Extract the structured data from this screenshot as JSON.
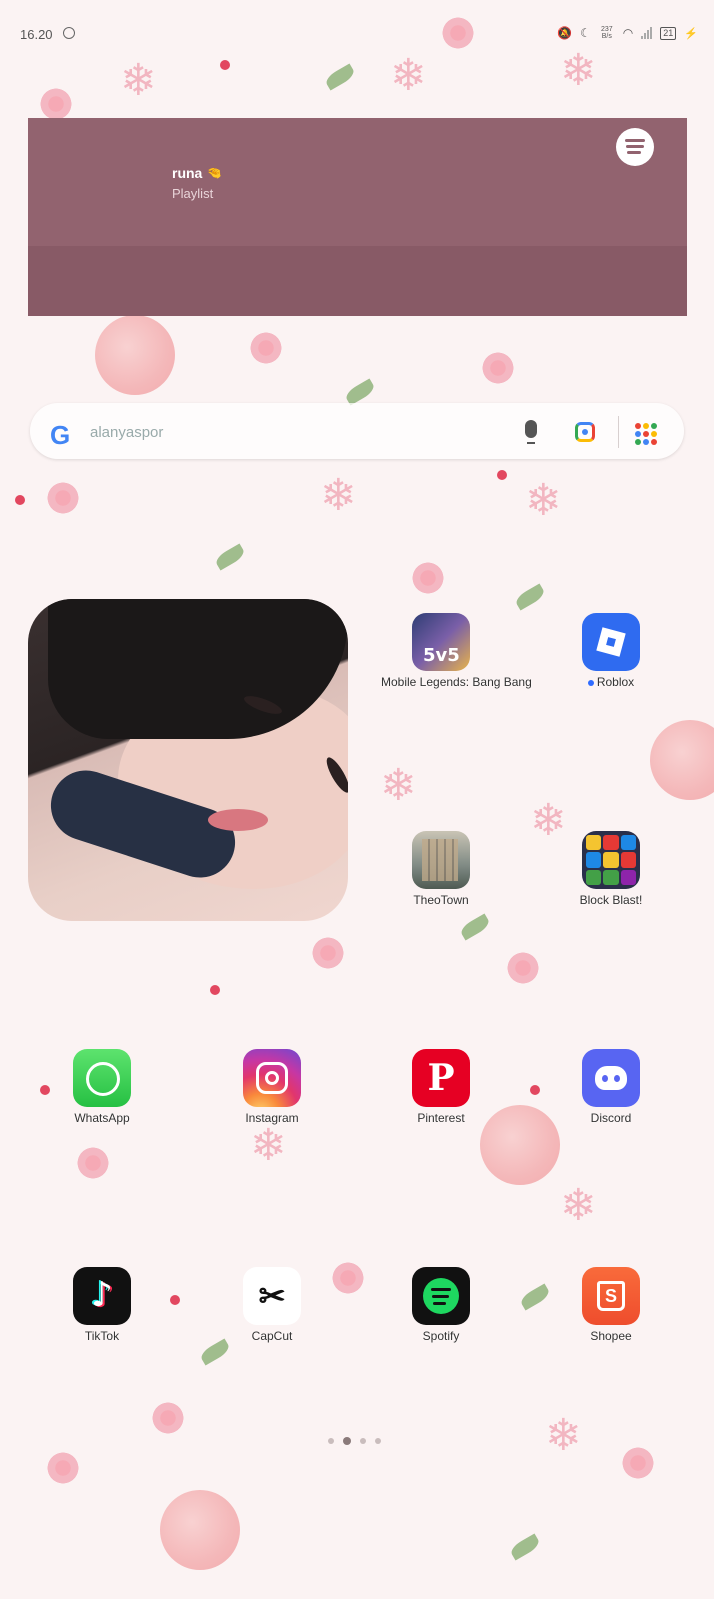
{
  "status_bar": {
    "time": "16.20",
    "speed_value": "237",
    "speed_unit": "B/s",
    "battery": "21",
    "icons": [
      "whatsapp-notification-icon",
      "mute-icon",
      "moon-icon",
      "wifi-icon",
      "signal-icon",
      "battery-icon",
      "charging-icon"
    ]
  },
  "spotify_widget": {
    "title": "runa",
    "title_emoji": "🤏",
    "subtitle": "Playlist",
    "background_color": "#92636f",
    "icon": "spotify-logo-icon"
  },
  "search_bar": {
    "query": "alanyaspor",
    "icons": [
      "google-logo-icon",
      "microphone-icon",
      "google-lens-icon",
      "apps-grid-icon"
    ],
    "google_letter": "G"
  },
  "photo_widget": {
    "description_icon": "photo-widget"
  },
  "apps": [
    {
      "label": "Mobile Legends: Bang Bang",
      "icon": "mobile-legends-icon",
      "icon_text": "5v5"
    },
    {
      "label": "Roblox",
      "icon": "roblox-icon",
      "new_indicator": true
    },
    {
      "label": "TheoTown",
      "icon": "theotown-icon"
    },
    {
      "label": "Block Blast!",
      "icon": "block-blast-icon"
    },
    {
      "label": "WhatsApp",
      "icon": "whatsapp-icon"
    },
    {
      "label": "Instagram",
      "icon": "instagram-icon"
    },
    {
      "label": "Pinterest",
      "icon": "pinterest-icon",
      "icon_text": "P"
    },
    {
      "label": "Discord",
      "icon": "discord-icon"
    },
    {
      "label": "TikTok",
      "icon": "tiktok-icon",
      "icon_text": "♪"
    },
    {
      "label": "CapCut",
      "icon": "capcut-icon",
      "icon_text": "✂"
    },
    {
      "label": "Spotify",
      "icon": "spotify-icon"
    },
    {
      "label": "Shopee",
      "icon": "shopee-icon",
      "icon_text": "S"
    }
  ],
  "pager": {
    "pages": 4,
    "active_index": 1
  },
  "colors": {
    "wallpaper_base": "#fbf3f3",
    "accent_pink": "#f2a4a6"
  }
}
